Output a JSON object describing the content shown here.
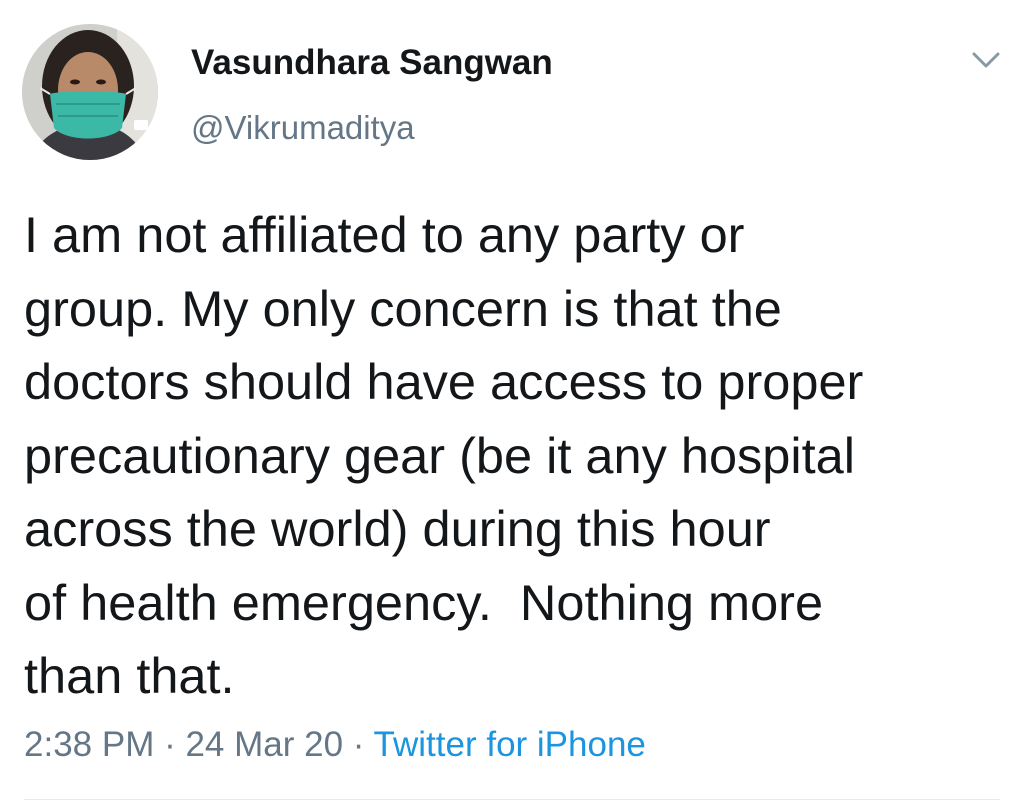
{
  "tweet": {
    "author": {
      "display_name": "Vasundhara Sangwan",
      "handle": "@Vikrumaditya",
      "avatar_icon": "profile-photo-masked-person"
    },
    "menu_icon": "chevron-down-icon",
    "text_lines": [
      "I am not affiliated to any party or",
      "group. My only concern is that the",
      "doctors should have access to proper",
      "precautionary gear (be it any hospital",
      "across the world) during this hour",
      "of health emergency.  Nothing more",
      "than that."
    ],
    "meta": {
      "time": "2:38 PM",
      "separator": " · ",
      "date": "24 Mar 20",
      "source": "Twitter for iPhone"
    }
  },
  "colors": {
    "text_primary": "#14171a",
    "text_secondary": "#657786",
    "link": "#1b95e0",
    "divider": "#e6ecf0"
  }
}
